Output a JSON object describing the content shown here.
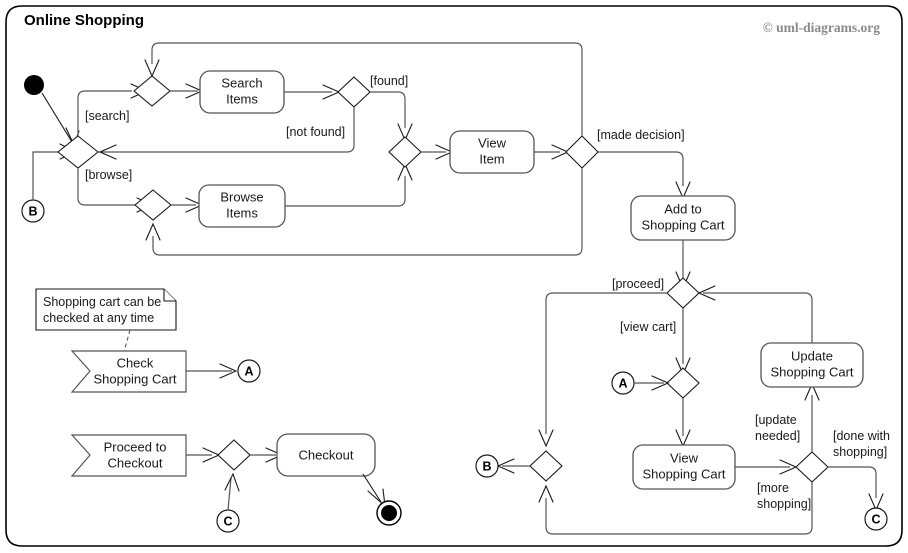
{
  "diagram": {
    "title": "Online Shopping",
    "copyright": "© uml-diagrams.org",
    "type": "uml-activity-diagram"
  },
  "actions": {
    "search_items": "Search\nItems",
    "search_items_line1": "Search",
    "search_items_line2": "Items",
    "browse_items_line1": "Browse",
    "browse_items_line2": "Items",
    "view_item_line1": "View",
    "view_item_line2": "Item",
    "add_to_cart_line1": "Add to",
    "add_to_cart_line2": "Shopping Cart",
    "update_cart_line1": "Update",
    "update_cart_line2": "Shopping Cart",
    "view_cart_line1": "View",
    "view_cart_line2": "Shopping Cart",
    "checkout": "Checkout"
  },
  "signals": {
    "check_cart_line1": "Check",
    "check_cart_line2": "Shopping Cart",
    "proceed_checkout_line1": "Proceed to",
    "proceed_checkout_line2": "Checkout"
  },
  "note": {
    "line1": "Shopping cart can be",
    "line2": "checked at any time"
  },
  "guards": {
    "search": "[search]",
    "browse": "[browse]",
    "found": "[found]",
    "not_found": "[not found]",
    "made_decision": "[made decision]",
    "proceed": "[proceed]",
    "view_cart": "[view cart]",
    "update_needed_line1": "[update",
    "update_needed_line2": "needed]",
    "more_shopping_line1": "[more",
    "more_shopping_line2": "shopping]",
    "done_with_shopping_line1": "[done with",
    "done_with_shopping_line2": "shopping]"
  },
  "connectors": {
    "a": "A",
    "b_left": "B",
    "b_right": "B",
    "c_bottom": "C",
    "c_right": "C"
  },
  "colors": {
    "frame_stroke": "#000000",
    "node_stroke": "#555555",
    "edge_stroke": "#555555",
    "text": "#1a1a1a",
    "copyright": "#8a8a8a",
    "background": "#ffffff"
  }
}
